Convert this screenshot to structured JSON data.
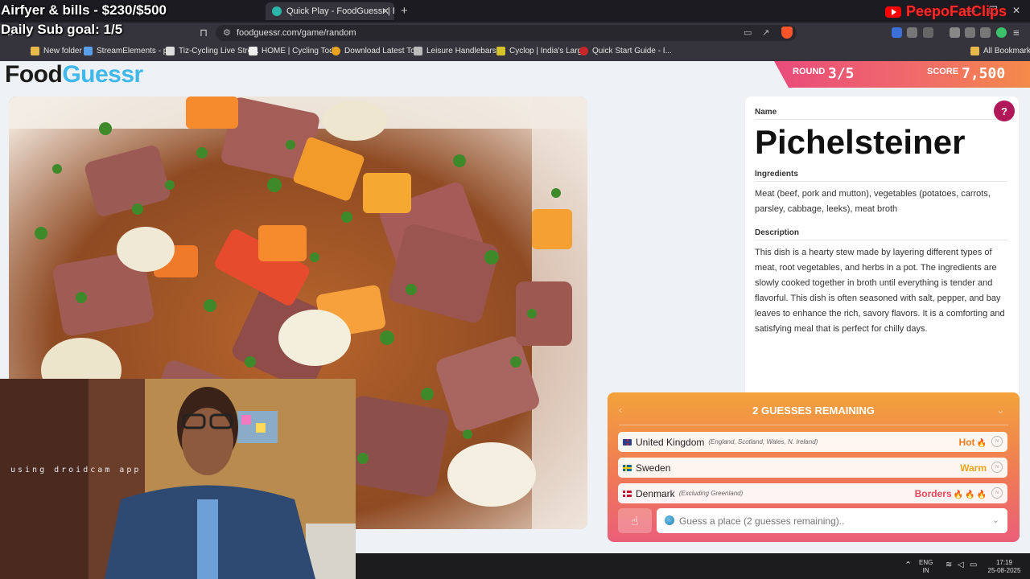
{
  "overlay": {
    "goal_text": "Airfyer & bills - $230/$500",
    "sub_goal_text": "Daily Sub goal: 1/5",
    "channel_name": "PeepoFatClips"
  },
  "browser": {
    "tab_title": "Quick Play - FoodGuessr | FoodG",
    "url": "foodguessr.com/game/random",
    "bookmarks": [
      "New folder",
      "StreamElements - p...",
      "Tiz-Cycling Live Stre...",
      "HOME | Cycling Tod...",
      "Download Latest To...",
      "Leisure Handlebars...",
      "Cyclop | India's Larg...",
      "Quick Start Guide - I..."
    ],
    "all_bookmarks": "All Bookmarks"
  },
  "game": {
    "logo_food": "Food",
    "logo_guessr": "Guessr",
    "round_label": "ROUND",
    "round_value": "3/5",
    "score_label": "SCORE",
    "score_value": "7,500"
  },
  "dish": {
    "name_label": "Name",
    "name": "Pichelsteiner",
    "ingredients_label": "Ingredients",
    "ingredients": "Meat (beef, pork and mutton), vegetables (potatoes, carrots, parsley, cabbage, leeks), meat broth",
    "description_label": "Description",
    "description": "This dish is a hearty stew made by layering different types of meat, root vegetables, and herbs in a pot. The ingredients are slowly cooked together in broth until everything is tender and flavorful. This dish is often seasoned with salt, pepper, and bay leaves to enhance the rich, savory flavors. It is a comforting and satisfying meal that is perfect for chilly days."
  },
  "guesses": {
    "header": "2 GUESSES REMAINING",
    "items": [
      {
        "country": "United Kingdom",
        "note": "(England, Scotland, Wales, N. Ireland)",
        "result": "Hot",
        "flames": 1,
        "color": "#f07b1c"
      },
      {
        "country": "Sweden",
        "note": "",
        "result": "Warm",
        "flames": 0,
        "color": "#e8a51c"
      },
      {
        "country": "Denmark",
        "note": "(Excluding Greenland)",
        "result": "Borders",
        "flames": 3,
        "color": "#e5485c"
      }
    ],
    "input_placeholder": "Guess a place (2 guesses remaining).."
  },
  "webcam": {
    "watermark": "using droidcam app"
  },
  "taskbar": {
    "lang_top": "ENG",
    "lang_bottom": "IN",
    "time": "17:19",
    "date": "25-08-2025"
  },
  "colors": {
    "accent": "#3fb8ec",
    "help": "#b0185a",
    "round_gradient_start": "#e94b7b",
    "round_gradient_end": "#f58a4a"
  }
}
